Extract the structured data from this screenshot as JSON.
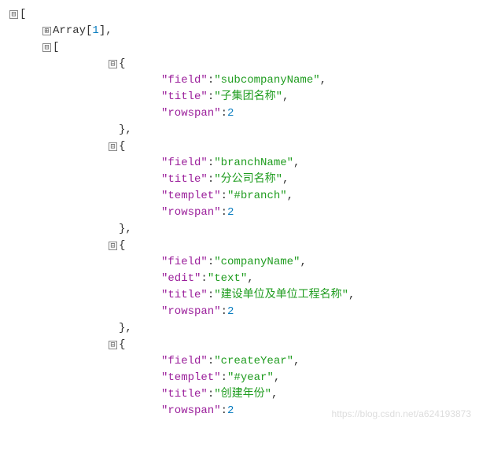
{
  "toggle_minus": "⊟",
  "toggle_plus": "⊞",
  "array_label": "Array",
  "array_len": 1,
  "keys": {
    "field": "\"field\"",
    "title": "\"title\"",
    "rowspan": "\"rowspan\"",
    "templet": "\"templet\"",
    "edit": "\"edit\""
  },
  "entries": [
    {
      "field": "\"subcompanyName\"",
      "title": "\"子集团名称\"",
      "rowspan": 2
    },
    {
      "field": "\"branchName\"",
      "title": "\"分公司名称\"",
      "templet": "\"#branch\"",
      "rowspan": 2
    },
    {
      "field": "\"companyName\"",
      "edit": "\"text\"",
      "title": "\"建设单位及单位工程名称\"",
      "rowspan": 2
    },
    {
      "field": "\"createYear\"",
      "templet": "\"#year\"",
      "title": "\"创建年份\"",
      "rowspan": 2
    }
  ],
  "punct": {
    "open_bracket": "[",
    "close_bracket": "]",
    "open_brace": "{",
    "close_brace": "}",
    "colon": ":",
    "comma": ","
  },
  "watermark": "https://blog.csdn.net/a624193873"
}
